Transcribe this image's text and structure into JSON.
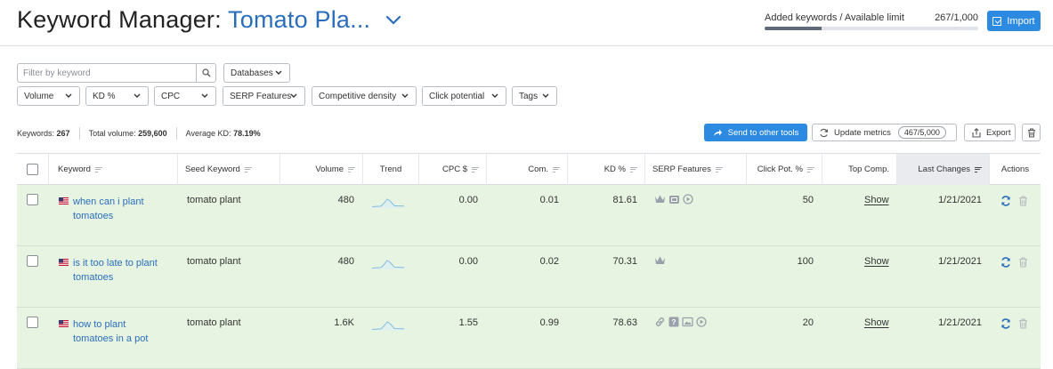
{
  "header": {
    "title_prefix": "Keyword Manager:",
    "project_name": "Tomato Pla...",
    "limit_label": "Added keywords / Available limit",
    "limit_value": "267/1,000",
    "limit_fraction": 0.267,
    "import_label": "Import"
  },
  "filters": {
    "search_placeholder": "Filter by keyword",
    "databases": "Databases",
    "volume": "Volume",
    "kd": "KD %",
    "cpc": "CPC",
    "serp": "SERP Features",
    "density": "Competitive density",
    "click": "Click potential",
    "tags": "Tags"
  },
  "stats": {
    "keywords_label": "Keywords:",
    "keywords_value": "267",
    "volume_label": "Total volume:",
    "volume_value": "259,600",
    "kd_label": "Average KD:",
    "kd_value": "78.19%"
  },
  "toolbar": {
    "send_label": "Send to other tools",
    "update_label": "Update metrics",
    "update_count": "467/5,000",
    "export_label": "Export"
  },
  "columns": {
    "keyword": "Keyword",
    "seed": "Seed Keyword",
    "volume": "Volume",
    "trend": "Trend",
    "cpc": "CPC $",
    "com": "Com.",
    "kd": "KD %",
    "serp": "SERP Features",
    "click": "Click Pot. %",
    "top": "Top Comp.",
    "last": "Last Changes",
    "actions": "Actions"
  },
  "rows": [
    {
      "keyword": "when can i plant tomatoes",
      "seed": "tomato plant",
      "volume": "480",
      "cpc": "0.00",
      "com": "0.01",
      "kd": "81.61",
      "click": "50",
      "top": "Show",
      "last": "1/21/2021",
      "serp_icons": [
        "crown-icon",
        "image-pack-icon",
        "video-icon"
      ]
    },
    {
      "keyword": "is it too late to plant tomatoes",
      "seed": "tomato plant",
      "volume": "480",
      "cpc": "0.00",
      "com": "0.02",
      "kd": "70.31",
      "click": "100",
      "top": "Show",
      "last": "1/21/2021",
      "serp_icons": [
        "crown-icon"
      ]
    },
    {
      "keyword": "how to plant tomatoes in a pot",
      "seed": "tomato plant",
      "volume": "1.6K",
      "cpc": "1.55",
      "com": "0.99",
      "kd": "78.63",
      "click": "20",
      "top": "Show",
      "last": "1/21/2021",
      "serp_icons": [
        "link-icon",
        "faq-icon",
        "image-icon",
        "video-icon"
      ]
    }
  ],
  "colors": {
    "accent": "#2d8ae1",
    "link": "#2a6ebb",
    "row_highlight": "#e7f4e1",
    "trend": "#5aa8d8"
  }
}
